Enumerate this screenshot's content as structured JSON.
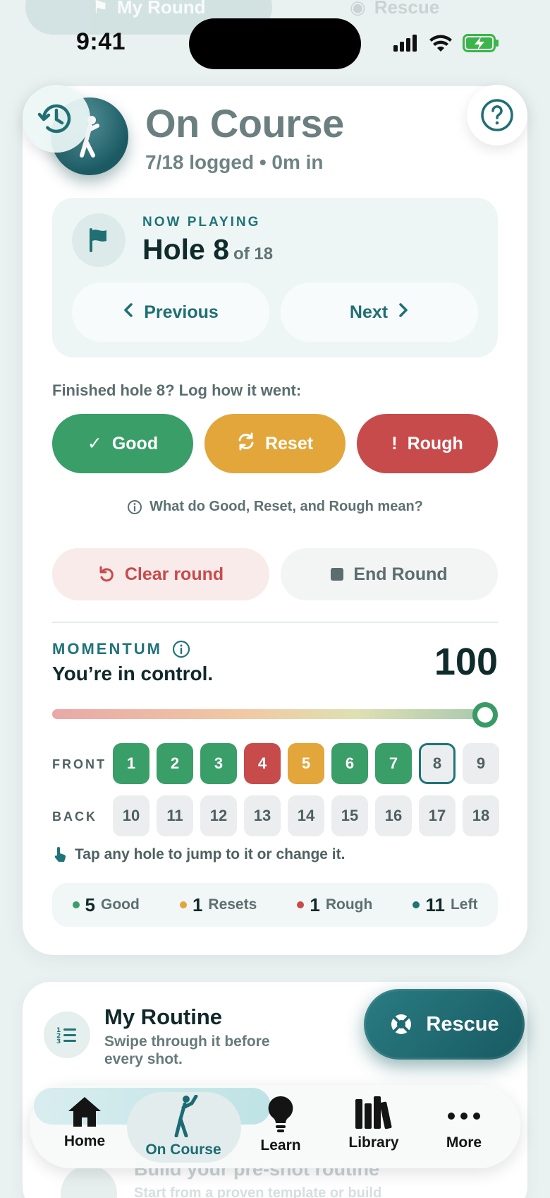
{
  "ghost_tabs": {
    "left": "My Round",
    "right": "Rescue"
  },
  "status": {
    "time": "9:41"
  },
  "header": {
    "title": "On Course",
    "subtitle": "7/18 logged • 0m in"
  },
  "now_playing": {
    "label": "NOW PLAYING",
    "hole_text": "Hole 8",
    "of_text": "of 18",
    "previous_label": "Previous",
    "next_label": "Next"
  },
  "log": {
    "prompt": "Finished hole 8? Log how it went:",
    "good_label": "Good",
    "reset_label": "Reset",
    "rough_label": "Rough",
    "help_text": "What do Good, Reset, and Rough mean?"
  },
  "actions": {
    "clear_label": "Clear round",
    "end_label": "End Round"
  },
  "momentum": {
    "label": "MOMENTUM",
    "message": "You’re in control.",
    "score": "100",
    "level": 1.0
  },
  "holes": {
    "front_label": "FRONT",
    "back_label": "BACK",
    "front": [
      {
        "n": "1",
        "status": "good"
      },
      {
        "n": "2",
        "status": "good"
      },
      {
        "n": "3",
        "status": "good"
      },
      {
        "n": "4",
        "status": "rough"
      },
      {
        "n": "5",
        "status": "reset"
      },
      {
        "n": "6",
        "status": "good"
      },
      {
        "n": "7",
        "status": "good"
      },
      {
        "n": "8",
        "status": "current"
      },
      {
        "n": "9",
        "status": "empty"
      }
    ],
    "back": [
      {
        "n": "10",
        "status": "empty"
      },
      {
        "n": "11",
        "status": "empty"
      },
      {
        "n": "12",
        "status": "empty"
      },
      {
        "n": "13",
        "status": "empty"
      },
      {
        "n": "14",
        "status": "empty"
      },
      {
        "n": "15",
        "status": "empty"
      },
      {
        "n": "16",
        "status": "empty"
      },
      {
        "n": "17",
        "status": "empty"
      },
      {
        "n": "18",
        "status": "empty"
      }
    ],
    "hint": "Tap any hole to jump to it or change it."
  },
  "summary": {
    "good_count": "5",
    "good_label": "Good",
    "reset_count": "1",
    "reset_label": "Resets",
    "rough_count": "1",
    "rough_label": "Rough",
    "left_count": "11",
    "left_label": "Left"
  },
  "routine": {
    "title": "My Routine",
    "subtitle": "Swipe through it before every shot.",
    "ghost_title": "Build your pre-shot routine",
    "ghost_sub": "Start from a proven template or build"
  },
  "rescue": {
    "label": "Rescue"
  },
  "tabs": [
    {
      "label": "Home",
      "icon": "house-icon"
    },
    {
      "label": "On Course",
      "icon": "golfer-icon"
    },
    {
      "label": "Learn",
      "icon": "lightbulb-icon"
    },
    {
      "label": "Library",
      "icon": "books-icon"
    },
    {
      "label": "More",
      "icon": "ellipsis-icon"
    }
  ],
  "colors": {
    "good": "#3a9e68",
    "reset": "#e2a63a",
    "rough": "#c84b4b",
    "accent": "#1f7478",
    "empty_hole": "#ebedee"
  }
}
